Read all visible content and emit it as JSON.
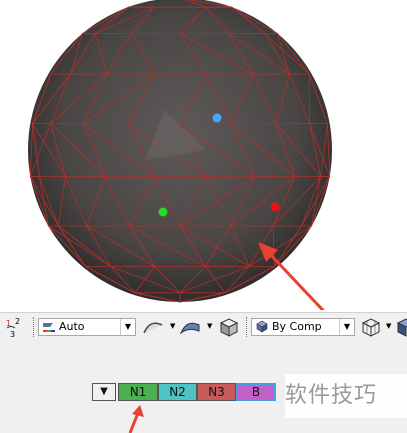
{
  "viewport": {
    "background": "#ffffff",
    "sphere_color": "#4a4747",
    "mesh_line_color": "#b0302a",
    "nodes": [
      {
        "name": "node-blue",
        "color": "#4aa3ff"
      },
      {
        "name": "node-green",
        "color": "#22dd22"
      },
      {
        "name": "node-red",
        "color": "#ee1111"
      }
    ],
    "annotation_arrow_color": "#e8412f"
  },
  "toolbar": {
    "display_mode_icon": "auto-display-icon",
    "display_mode_value": "Auto",
    "color_mode_icon": "by-comp-icon",
    "color_mode_value": "By Comp"
  },
  "node_picker": {
    "buttons": [
      {
        "label": "N1",
        "color": "#4caf50"
      },
      {
        "label": "N2",
        "color": "#4ec3c3"
      },
      {
        "label": "N3",
        "color": "#c85a5a"
      },
      {
        "label": "B",
        "color": "#c060c8"
      }
    ]
  },
  "watermark": "软件技巧"
}
